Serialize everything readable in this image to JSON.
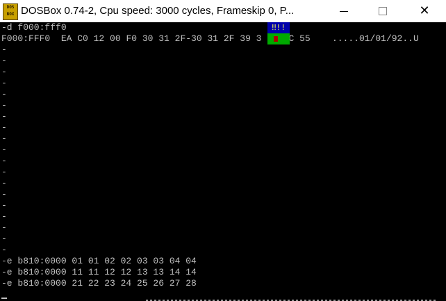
{
  "window": {
    "title": "DOSBox 0.74-2, Cpu speed:     3000 cycles, Frameskip  0, P...",
    "icon_label": "DOS BOX"
  },
  "screen": {
    "command": "-d f000:fff0",
    "dump_address": "F000:FFF0",
    "dump_bytes_left": "EA C0 12 00 F0 30 31 2F-30 31 2F 39 3",
    "dump_bytes_right": "FC 55",
    "dump_ascii": ".....01/01/92..U",
    "overlay_glyph": "‼!!",
    "empty_prompt": "-",
    "edit_lines": [
      "-e b810:0000 01 01 02 02 03 03 04 04",
      "-e b810:0000 11 11 12 12 13 13 14 14",
      "-e b810:0000 21 22 23 24 25 26 27 28"
    ]
  },
  "colors": {
    "screen_bg": "#000000",
    "text": "#c0c0c0",
    "overlay_blue": "#0000aa",
    "overlay_green": "#00aa00",
    "overlay_red": "#aa0000"
  }
}
